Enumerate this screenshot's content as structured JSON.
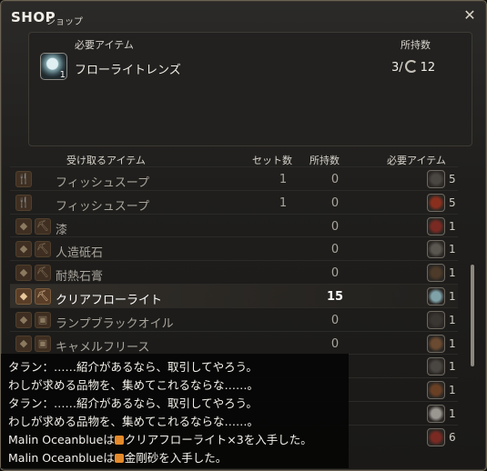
{
  "window": {
    "title": "SHOP",
    "subtitle": "ショップ"
  },
  "requirement": {
    "header_left": "必要アイテム",
    "header_right": "所持数",
    "item_icon": "clear-fluorite-lens-icon",
    "item_qty": "1",
    "item_name": "フローライトレンズ",
    "held_prefix": "3/",
    "held_icon": "gil-icon",
    "held_suffix": "12"
  },
  "columns": {
    "receive": "受け取るアイテム",
    "sets": "セット数",
    "held": "所持数",
    "required": "必要アイテム"
  },
  "rows": [
    {
      "icons": [
        "fork-knife-icon"
      ],
      "name": "フィッシュスープ",
      "sets": "1",
      "held": "0",
      "req_icon": "rod-icon",
      "req_qty": "5"
    },
    {
      "icons": [
        "fork-knife-icon"
      ],
      "name": "フィッシュスープ",
      "sets": "1",
      "held": "0",
      "req_icon": "red-orb-icon",
      "req_qty": "5"
    },
    {
      "icons": [
        "mineral-icon",
        "pickaxe-icon"
      ],
      "name": "漆",
      "sets": "",
      "held": "0",
      "req_icon": "red-stone-icon",
      "req_qty": "1"
    },
    {
      "icons": [
        "mineral-icon",
        "pickaxe-icon"
      ],
      "name": "人造砥石",
      "sets": "",
      "held": "0",
      "req_icon": "sword-icon",
      "req_qty": "1"
    },
    {
      "icons": [
        "mineral-icon",
        "pickaxe-icon"
      ],
      "name": "耐熱石膏",
      "sets": "",
      "held": "0",
      "req_icon": "bottle-icon",
      "req_qty": "1"
    },
    {
      "icons": [
        "mineral-icon",
        "pickaxe-icon"
      ],
      "name": "クリアフローライト",
      "sets": "",
      "held": "15",
      "req_icon": "clear-fluorite-lens-icon",
      "req_qty": "1",
      "selected": true
    },
    {
      "icons": [
        "mineral-icon",
        "chest-icon"
      ],
      "name": "ランプブラックオイル",
      "sets": "",
      "held": "0",
      "req_icon": "dark-stone-icon",
      "req_qty": "1"
    },
    {
      "icons": [
        "mineral-icon",
        "chest-icon"
      ],
      "name": "キャメルフリース",
      "sets": "",
      "held": "0",
      "req_icon": "leather-icon",
      "req_qty": "1"
    },
    {
      "icons": [],
      "name": "",
      "sets": "",
      "held": "",
      "req_icon": "rod-icon",
      "req_qty": "1"
    },
    {
      "icons": [],
      "name": "",
      "sets": "",
      "held": "",
      "req_icon": "brown-orb-icon",
      "req_qty": "1"
    },
    {
      "icons": [],
      "name": "",
      "sets": "",
      "held": "",
      "req_icon": "pearl-icon",
      "req_qty": "1"
    },
    {
      "icons": [],
      "name": "",
      "sets": "",
      "held": "",
      "req_icon": "red-stone-icon",
      "req_qty": "6"
    }
  ],
  "chat": [
    {
      "text": "タラン：……紹介があるなら、取引してやろう。"
    },
    {
      "text": "わしが求める品物を、集めてこれるならな……。"
    },
    {
      "text": "タラン：……紹介があるなら、取引してやろう。"
    },
    {
      "text": "わしが求める品物を、集めてこれるならな……。"
    },
    {
      "prefix": "Malin Oceanblueは",
      "marker": true,
      "text": "クリアフローライト×3を入手した。"
    },
    {
      "prefix": "Malin Oceanblueは",
      "marker": true,
      "text": "金剛砂を入手した。"
    }
  ],
  "colors": {
    "accent": "#e48a2a",
    "frame": "#6b6455",
    "text": "#e8e4dc",
    "dim_text": "#a9a59c"
  }
}
